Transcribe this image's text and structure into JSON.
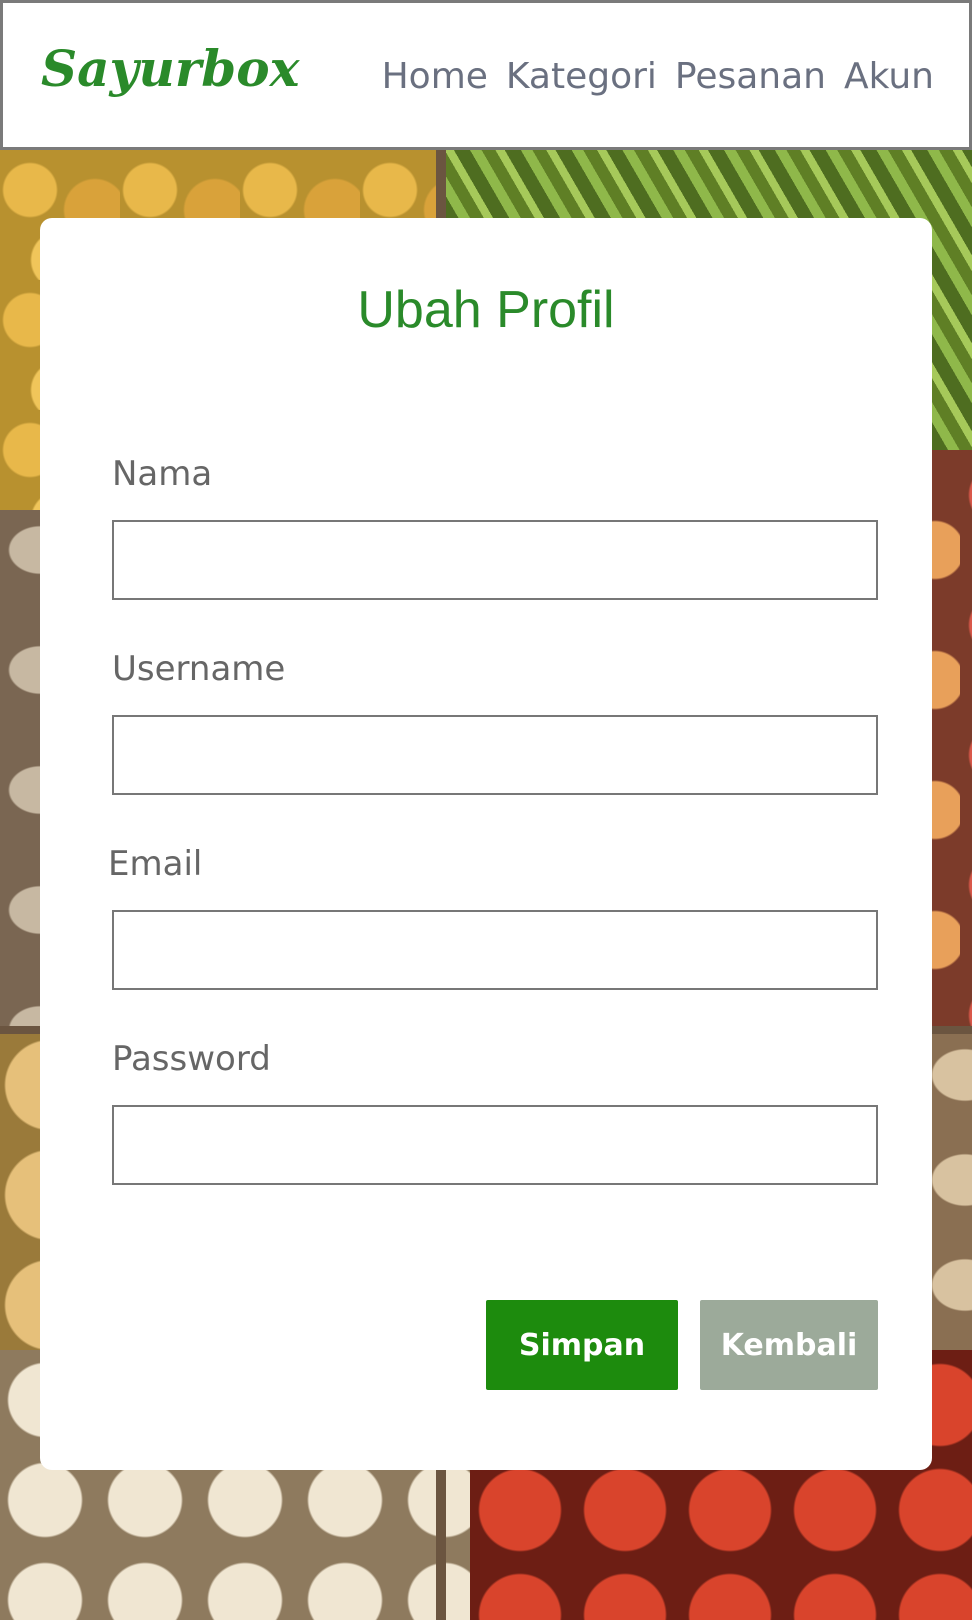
{
  "navbar": {
    "logo": "Sayurbox",
    "links": [
      "Home",
      "Kategori",
      "Pesanan",
      "Akun"
    ]
  },
  "form": {
    "title": "Ubah Profil",
    "fields": [
      {
        "label": "Nama",
        "value": "",
        "placeholder": ""
      },
      {
        "label": "Username",
        "value": "",
        "placeholder": ""
      },
      {
        "label": "Email",
        "value": "",
        "placeholder": ""
      },
      {
        "label": "Password",
        "value": "",
        "placeholder": ""
      }
    ],
    "save_label": "Simpan",
    "back_label": "Kembali"
  },
  "colors": {
    "brand_green": "#2a8a2a",
    "save_button": "#1d8b0d",
    "back_button": "#9caa9a",
    "nav_text": "#6a7080"
  }
}
